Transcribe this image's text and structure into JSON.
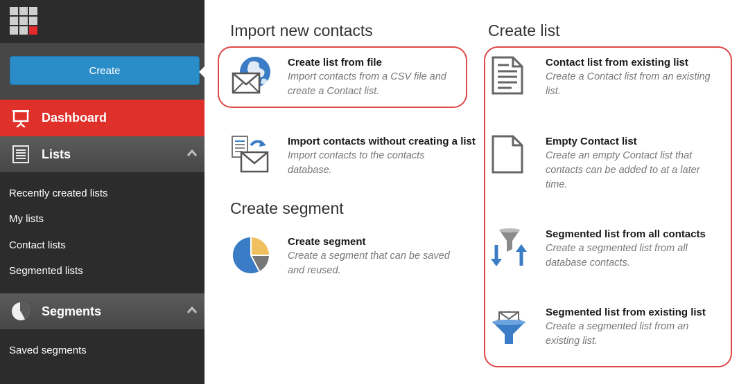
{
  "sidebar": {
    "create_label": "Create",
    "dashboard_label": "Dashboard",
    "lists_label": "Lists",
    "lists_items": [
      "Recently created lists",
      "My lists",
      "Contact lists",
      "Segmented lists"
    ],
    "segments_label": "Segments",
    "segments_items": [
      "Saved segments"
    ]
  },
  "main": {
    "import_heading": "Import new contacts",
    "segment_heading": "Create segment",
    "create_list_heading": "Create list",
    "items": {
      "from_file": {
        "title": "Create list from file",
        "desc1": "Import contacts from a CSV file and",
        "desc2": "create a Contact list."
      },
      "import_no_list": {
        "title": "Import contacts without creating a list",
        "desc1": "Import contacts to the contacts",
        "desc2": "database."
      },
      "create_segment": {
        "title": "Create segment",
        "desc1": "Create a segment that can be saved",
        "desc2": "and reused."
      },
      "from_existing": {
        "title": "Contact list from existing list",
        "desc1": "Create a Contact list from an existing",
        "desc2": "list."
      },
      "empty": {
        "title": "Empty Contact list",
        "desc1": "Create an empty Contact list that",
        "desc2": "contacts can be added to at a later",
        "desc3": "time."
      },
      "seg_all": {
        "title": "Segmented list from all contacts",
        "desc1": "Create a segmented list from all",
        "desc2": "database contacts."
      },
      "seg_existing": {
        "title": "Segmented list from existing list",
        "desc1": "Create a segmented list from an",
        "desc2": "existing list."
      }
    }
  },
  "colors": {
    "accent_blue": "#2b8dc8",
    "dashboard_red": "#e0302a",
    "highlight_red": "#e04747"
  }
}
